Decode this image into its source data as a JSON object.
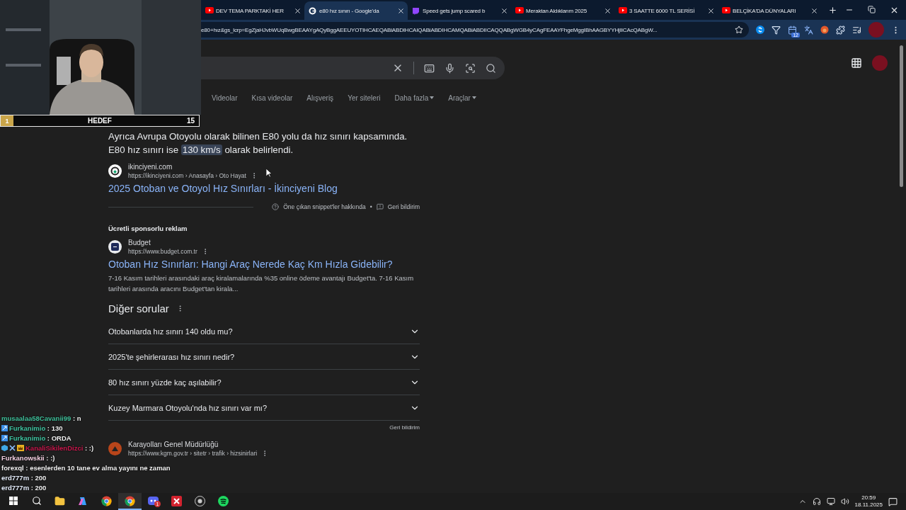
{
  "webcam": {
    "kind": "picture",
    "goal": {
      "rank": "1",
      "label": "HEDEF",
      "count": "15"
    }
  },
  "tabs": [
    {
      "title": "DEV TEMA PARKTAKİ HER",
      "kind": "youtube",
      "selected": false
    },
    {
      "title": "e80 hız sınırı - Google'da",
      "kind": "google",
      "selected": true
    },
    {
      "title": "Speed gets jump scared b",
      "kind": "twitch",
      "selected": false
    },
    {
      "title": "Meraktan Aldıklarım 2025",
      "kind": "youtube",
      "selected": false
    },
    {
      "title": "3 SAATTE 6000 TL SERİSİ",
      "kind": "youtube",
      "selected": false
    },
    {
      "title": "BELÇİKA'DA DÜNYALARI",
      "kind": "youtube",
      "selected": false
    }
  ],
  "address_bar": {
    "url": "e80+hız&gs_lcrp=EgZjaHJvbWUqBwgBEAAYgAQyBggAEEUYOTIHCAEQABiABDIHCAIQABiABDIHCAMQABiABDIICAQQABgWGB4yCAgFEAAYFhgeMggIBhAAGBYYHjIICAcQABgW..."
  },
  "extensions": [
    {
      "kind": "shazam"
    },
    {
      "kind": "filter"
    },
    {
      "kind": "calendar",
      "badge": "12"
    },
    {
      "kind": "translate"
    },
    {
      "kind": "fox"
    },
    {
      "kind": "puzzle"
    }
  ],
  "search_nav": [
    {
      "label": "Videolar",
      "menu": false
    },
    {
      "label": "Kısa videolar",
      "menu": false
    },
    {
      "label": "Alışveriş",
      "menu": false
    },
    {
      "label": "Yer siteleri",
      "menu": false
    },
    {
      "label": "Daha fazla",
      "menu": true
    },
    {
      "label": "Araçlar",
      "menu": true
    }
  ],
  "snippet": {
    "before": "Ayrıca Avrupa Otoyolu olarak bilinen E80 yolu da hız sınırı kapsamında. E80 hız sınırı ise ",
    "highlight": "130 km/s",
    "after": " olarak belirlendi.",
    "site": "ikinciyeni.com",
    "url": "https://ikinciyeni.com › Anasayfa › Oto Hayat",
    "title": "2025 Otoban ve Otoyol Hız Sınırları - İkinciyeni Blog",
    "about": "Öne çıkan snippet'ler hakkında",
    "dot": "•",
    "feedback": "Geri bildirim"
  },
  "ad": {
    "label": "Ücretli sponsorlu reklam",
    "site": "Budget",
    "url": "https://www.budget.com.tr",
    "title": "Otoban Hız Sınırları: Hangi Araç Nerede Kaç Km Hızla Gidebilir?",
    "description": "7-16 Kasım tarihleri arasındaki araç kiralamalarında %35 online ödeme avantajı Budget'ta. 7-16 Kasım tarihleri arasında aracını Budget'tan kirala..."
  },
  "questions": {
    "heading": "Diğer sorular",
    "items": [
      {
        "text": "Otobanlarda hız sınırı 140 oldu mu?",
        "expanded": false
      },
      {
        "text": "2025'te şehirlerarası hız sınırı nedir?",
        "expanded": false
      },
      {
        "text": "80 hız sınırı yüzde kaç aşılabilir?",
        "expanded": false
      },
      {
        "text": "Kuzey Marmara Otoyolu'nda hız sınırı var mı?",
        "expanded": false
      }
    ],
    "feedback": "Geri bildirim"
  },
  "result": {
    "site": "Karayolları Genel Müdürlüğü",
    "url": "https://www.kgm.gov.tr › sitetr › trafik › hizsinirlari"
  },
  "chat": [
    {
      "user": "musaalaa58Cavanii99",
      "text": ": n",
      "color": "#3fbf9a"
    },
    {
      "user": "Furkanimio",
      "text": ": 130",
      "color": "#3fc3a0",
      "badges": [
        {
          "kind": "sub"
        }
      ]
    },
    {
      "user": "Furkanimio",
      "text": ": ORDA",
      "color": "#3fc3a0",
      "badges": [
        {
          "kind": "sub"
        }
      ]
    },
    {
      "user": "KanaliSikilenDizci",
      "text": ": :)",
      "color": "#c8174c",
      "badges": [
        {
          "kind": "cube"
        },
        {
          "kind": "swords"
        },
        {
          "kind": "crown"
        }
      ]
    },
    {
      "user": "Furkanowskii",
      "text": ": :)",
      "color": "#f2cfe0"
    },
    {
      "user": "forexql",
      "text": ": esenlerden 10 tane ev alma yayını ne zaman",
      "color": "#f4f4f4"
    },
    {
      "user": "erd777m",
      "text": ": 200",
      "color": "#e8f0ff"
    },
    {
      "user": "erd777m",
      "text": ": 200",
      "color": "#e8f0ff"
    }
  ],
  "taskbar": {
    "apps": [
      {
        "kind": "start",
        "active": false
      },
      {
        "kind": "search",
        "active": false
      },
      {
        "kind": "folder",
        "active": false
      },
      {
        "kind": "copilot",
        "active": false
      },
      {
        "kind": "chrome",
        "active": false
      },
      {
        "kind": "chrome",
        "active": true
      },
      {
        "kind": "discord",
        "active": false,
        "badge": "1"
      },
      {
        "kind": "xapp",
        "active": false
      },
      {
        "kind": "obs",
        "active": false
      },
      {
        "kind": "spotify",
        "active": false
      }
    ],
    "time": "20:59",
    "date": "18.11.2025"
  }
}
